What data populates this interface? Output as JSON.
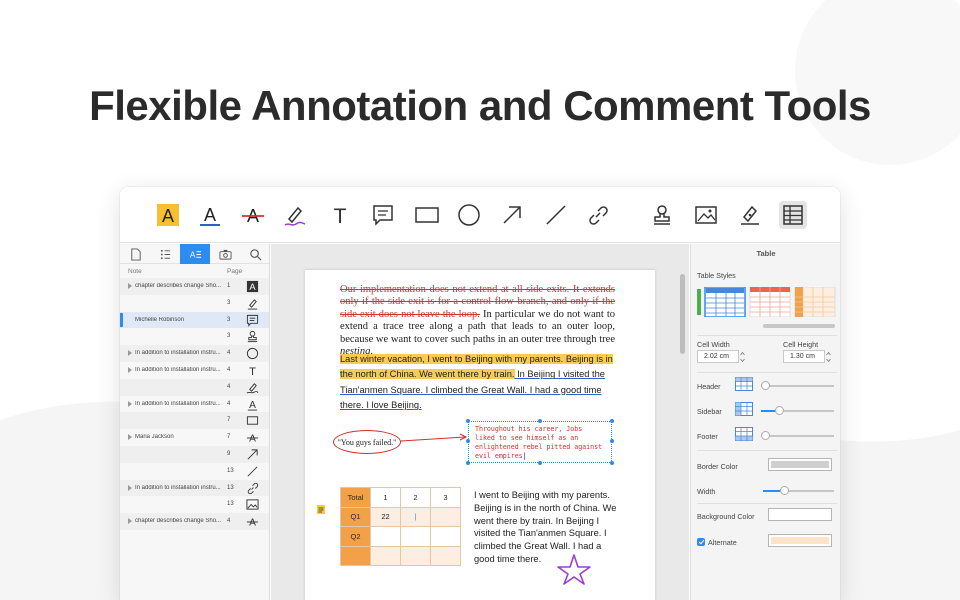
{
  "headline": "Flexible Annotation and Comment Tools",
  "toolbar": {
    "tools": [
      "highlight-icon",
      "underline-icon",
      "strikethrough-icon",
      "freehand-pen-icon",
      "text-icon",
      "comment-icon",
      "rectangle-icon",
      "ellipse-icon",
      "arrow-icon",
      "line-icon",
      "link-icon",
      "stamp-icon",
      "image-icon",
      "signature-icon",
      "table-icon"
    ],
    "highlight_color": "#f7c033",
    "underline_color": "#2a62c9",
    "strike_color": "#d0312d",
    "pen_color": "#9b3fd1",
    "highlight_glyph": "A",
    "underline_glyph": "A",
    "strike_glyph": "A",
    "text_glyph": "T"
  },
  "left_panel": {
    "tabs": [
      "page-icon",
      "outline-icon",
      "annotation-list-icon",
      "snapshot-icon",
      "search-icon"
    ],
    "header_note": "Note",
    "header_page": "Page",
    "rows": [
      {
        "text": "chapter describes change Sho...",
        "page": "1",
        "icon": "highlight-icon",
        "arrow": true
      },
      {
        "text": "",
        "page": "3",
        "icon": "signature-icon",
        "arrow": false
      },
      {
        "text": "Michelle Robinson",
        "page": "3",
        "icon": "comment-icon",
        "arrow": false
      },
      {
        "text": "",
        "page": "3",
        "icon": "stamp-icon",
        "arrow": false
      },
      {
        "text": "In addition to installation instru...",
        "page": "4",
        "icon": "ellipse-icon",
        "arrow": true
      },
      {
        "text": "In addition to installation instru...",
        "page": "4",
        "icon": "text-icon",
        "arrow": true
      },
      {
        "text": "",
        "page": "4",
        "icon": "freehand-pen-icon",
        "arrow": false
      },
      {
        "text": "In addition to installation instru...",
        "page": "4",
        "icon": "underline-icon",
        "arrow": true
      },
      {
        "text": "",
        "page": "7",
        "icon": "rectangle-icon",
        "arrow": false
      },
      {
        "text": "Maria Jackson",
        "page": "7",
        "icon": "strikethrough-icon",
        "arrow": true
      },
      {
        "text": "",
        "page": "9",
        "icon": "arrow-icon",
        "arrow": false
      },
      {
        "text": "",
        "page": "13",
        "icon": "line-icon",
        "arrow": false
      },
      {
        "text": "In addition to installation instru...",
        "page": "13",
        "icon": "link-icon",
        "arrow": true
      },
      {
        "text": "",
        "page": "13",
        "icon": "image-icon",
        "arrow": false
      },
      {
        "text": "chapter describes change Sho...",
        "page": "4",
        "icon": "strikethrough-icon",
        "arrow": true
      }
    ]
  },
  "document": {
    "para1_struck": "Our implementation does not extend at all side exits. It extends only if the side exit is for a control-flow branch, and only if the side exit does not leave the loop.",
    "para1_rest": " In particular we do not want to extend a trace tree along a path that leads to an outer loop, because we want to cover such paths in an outer tree through tree ",
    "para1_italic": "nesting",
    "para1_end": ".",
    "para2_highlighted": "Last winter vacation, I went to Beijing with my parents. Beijing is in the north of China. We went there by train.",
    "para2_underlined": " In Beijing I visited the Tian'anmen Square. I climbed the Great Wall. I had a good time there. I love Beijing.",
    "ellipse_text": "\"You guys failed.\"",
    "callout_text": "Throughout his career, Jobs liked to see himself as an enlightened rebel pitted against evil empires",
    "table": {
      "header": [
        "Total",
        "1",
        "2",
        "3"
      ],
      "rows": [
        [
          "Q1",
          "22",
          "|",
          ""
        ],
        [
          "Q2",
          "",
          "",
          ""
        ],
        [
          "",
          "",
          "",
          ""
        ]
      ]
    },
    "para3": "I went to Beijing with my parents. Beijing is in the north of China. We went there by train. In Beijing I visited the Tian'anmen Square. I climbed the Great Wall. I had a good time there."
  },
  "right_panel": {
    "title": "Table",
    "table_styles_label": "Table Styles",
    "style_colors": [
      "#4a86d8",
      "#e8664a",
      "#f2a148"
    ],
    "cell_width_label": "Cell Width",
    "cell_width_value": "2.02 cm",
    "cell_height_label": "Cell Height",
    "cell_height_value": "1.30 cm",
    "header_label": "Header",
    "header_level": 0,
    "sidebar_label": "Sidebar",
    "sidebar_level": 0.22,
    "footer_label": "Footer",
    "footer_level": 0,
    "border_color_label": "Border Color",
    "border_color": "#cfcfcf",
    "width_label": "Width",
    "width_level": 0.28,
    "background_color_label": "Background Color",
    "background_color": "#ffffff",
    "alternate_label": "Alternate",
    "alternate_checked": true,
    "alternate_color": "#fde3c8"
  }
}
